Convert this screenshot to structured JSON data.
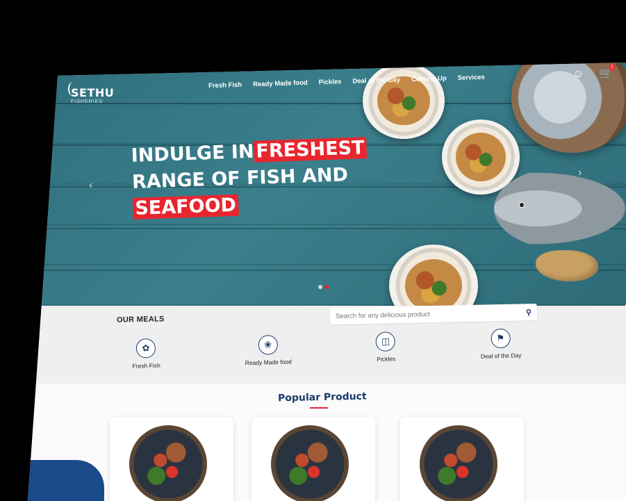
{
  "brand": {
    "name": "SETHU",
    "tagline": "FISHERIES"
  },
  "nav": {
    "items": [
      "Fresh Fish",
      "Ready Made food",
      "Pickles",
      "Deal of the Day",
      "Coming Up",
      "Services"
    ]
  },
  "header": {
    "cart_count": "1",
    "user_icon": "user-icon",
    "cart_icon": "cart-icon"
  },
  "hero": {
    "line1_plain": "INDULGE IN",
    "line1_highlight": "FRESHEST",
    "line2": "RANGE OF FISH AND",
    "line3_highlight": "SEAFOOD",
    "slides": 2,
    "active_slide": 2
  },
  "meals": {
    "title": "OUR MEALS",
    "search_placeholder": "Search for any delicious product",
    "categories": [
      {
        "label": "Fresh Fish",
        "icon": "fish-icon"
      },
      {
        "label": "Ready Made food",
        "icon": "food-icon"
      },
      {
        "label": "Pickles",
        "icon": "jar-icon"
      },
      {
        "label": "Deal of the Day",
        "icon": "tag-icon"
      }
    ]
  },
  "popular": {
    "title": "Popular Product"
  },
  "colors": {
    "accent": "#e8262f",
    "primary": "#1b3a6b",
    "hero_bg": "#3b7f8c"
  }
}
